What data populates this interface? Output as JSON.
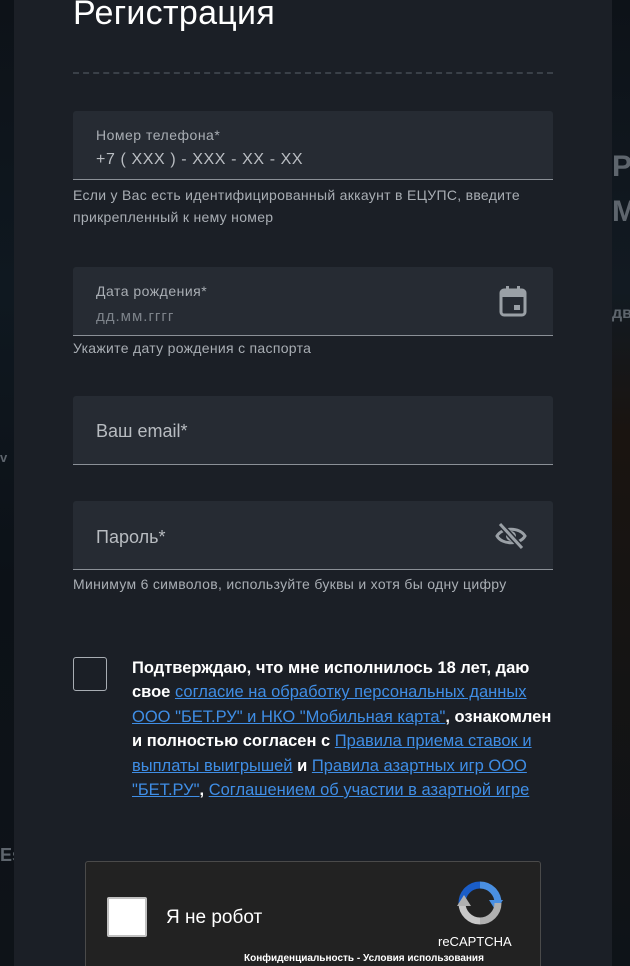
{
  "background": {
    "left_fragments": [
      "v",
      "Es"
    ],
    "right_fragments": [
      "P",
      "M",
      "дв"
    ]
  },
  "title": "Регистрация",
  "phone": {
    "label": "Номер телефона*",
    "value": "+7 ( XXX ) - XXX - XX - XX",
    "hint": "Если у Вас есть идентифицированный аккаунт в ЕЦУПС, введите прикрепленный к нему номер"
  },
  "birthdate": {
    "label": "Дата рождения*",
    "placeholder": "дд.мм.гггг",
    "icon": "calendar-icon",
    "hint": "Укажите дату рождения с паспорта"
  },
  "email": {
    "placeholder": "Ваш email*"
  },
  "password": {
    "placeholder": "Пароль*",
    "icon": "eye-off-icon",
    "hint": "Минимум 6 символов, используйте буквы и хотя бы одну цифру"
  },
  "consent": {
    "checked": false,
    "text_1": "Подтверждаю, что мне исполнилось 18 лет, даю свое",
    "link_1": "согласие на обработку персональных данных ООО \"БЕТ.РУ\" и НКО \"Мобильная карта\"",
    "text_2": ", ознакомлен и полностью согласен с",
    "link_2": "Правила приема ставок и выплаты выигрышей",
    "text_3": "и",
    "link_3": "Правила азартных игр ООО \"БЕТ.РУ\"",
    "text_4": ",",
    "link_4": "Соглашением об участии в азартной игре"
  },
  "captcha": {
    "label": "Я не робот",
    "brand": "reCAPTCHA",
    "privacy": "Конфиденциальность",
    "separator": "-",
    "terms": "Условия использования"
  },
  "colors": {
    "modal_bg": "#1b1f26",
    "field_bg": "#262b33",
    "link": "#3f8ee6",
    "text": "#ffffff"
  }
}
